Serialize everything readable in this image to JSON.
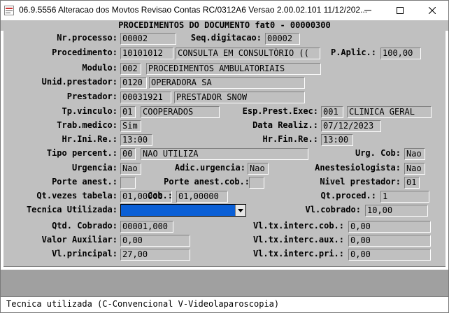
{
  "window": {
    "title": "06.9.5556  Alteracao  dos Movtos Revisao Contas RC/0312A6 Versao 2.00.02.101 11/12/202...",
    "icon": "app-icon",
    "controls": [
      "minimize-icon",
      "maximize-icon",
      "close-icon"
    ]
  },
  "header": {
    "title": "PROCEDIMENTOS DO DOCUMENTO fat0 - 00000300"
  },
  "form": {
    "nr_processo": {
      "label": "Nr.processo:",
      "value": "00002"
    },
    "seq_digitacao": {
      "label": "Seq.digitacao:",
      "value": "00002"
    },
    "procedimento": {
      "label": "Procedimento:",
      "code": "10101012",
      "desc": "CONSULTA EM CONSULTÓRIO (("
    },
    "p_aplic": {
      "label": "P.Aplic.:",
      "value": "100,00"
    },
    "modulo": {
      "label": "Modulo:",
      "code": "002",
      "desc": "PROCEDIMENTOS AMBULATORIAIS"
    },
    "unid_prestador": {
      "label": "Unid.prestador:",
      "code": "0120",
      "desc": "OPERADORA SA"
    },
    "prestador": {
      "label": "Prestador:",
      "code": "00031921",
      "desc": "PRESTADOR SNOW"
    },
    "tp_vinculo": {
      "label": "Tp.vinculo:",
      "code": "01",
      "desc": "COOPERADOS"
    },
    "esp_prest_exec": {
      "label": "Esp.Prest.Exec:",
      "code": "001",
      "desc": "CLINICA GERAL"
    },
    "trab_medico": {
      "label": "Trab.medico:",
      "value": "Sim"
    },
    "data_realiz": {
      "label": "Data Realiz.:",
      "value": "07/12/2023"
    },
    "hr_ini_re": {
      "label": "Hr.Ini.Re.:",
      "value": "13:00"
    },
    "hr_fin_re": {
      "label": "Hr.Fin.Re.:",
      "value": "13:00"
    },
    "tipo_percent": {
      "label": "Tipo percent.:",
      "code": "00",
      "desc": "NAO UTILIZA"
    },
    "urg_cob": {
      "label": "Urg. Cob:",
      "value": "Nao"
    },
    "urgencia": {
      "label": "Urgencia:",
      "value": "Nao"
    },
    "adic_urgencia": {
      "label": "Adic.urgencia:",
      "value": "Nao"
    },
    "anestesiologista": {
      "label": "Anestesiologista:",
      "value": "Nao"
    },
    "porte_anest": {
      "label": "Porte anest.:",
      "value": ""
    },
    "porte_anest_cob": {
      "label": "Porte anest.cob.:",
      "value": ""
    },
    "nivel_prestador": {
      "label": "Nivel prestador:",
      "value": "01"
    },
    "qt_vezes_tabela": {
      "label": "Qt.vezes tabela:",
      "value": "01,00000"
    },
    "cob": {
      "label": "Cob.:",
      "value": "01,00000"
    },
    "qt_proced": {
      "label": "Qt.proced.:",
      "value": "1"
    },
    "tecnica_utilizada": {
      "label": "Tecnica Utilizada:",
      "value": ""
    },
    "vl_cobrado": {
      "label": "Vl.cobrado:",
      "value": "10,00"
    },
    "qtd_cobrado": {
      "label": "Qtd. Cobrado:",
      "value": "00001,000"
    },
    "vl_tx_interc_cob": {
      "label": "Vl.tx.interc.cob.:",
      "value": "0,00"
    },
    "valor_auxiliar": {
      "label": "Valor Auxiliar:",
      "value": "0,00"
    },
    "vl_tx_interc_aux": {
      "label": "Vl.tx.interc.aux.:",
      "value": "0,00"
    },
    "vl_principal": {
      "label": "Vl.principal:",
      "value": "27,00"
    },
    "vl_tx_interc_pri": {
      "label": "Vl.tx.interc.pri.:",
      "value": "0,00"
    }
  },
  "status_bar": {
    "text": "Tecnica utilizada (C-Convencional  V-Videolaparoscopia)"
  },
  "colors": {
    "form_bg": "#c0c0c0",
    "selection": "#0a5fd6",
    "band": "#a0a0a0"
  }
}
